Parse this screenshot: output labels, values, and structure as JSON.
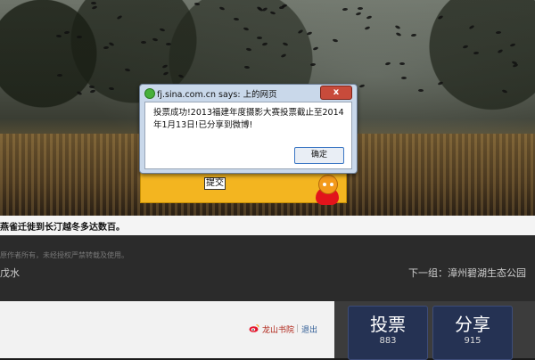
{
  "dialog": {
    "title": "fj.sina.com.cn says: 上的网页",
    "message": "投票成功!2013福建年度摄影大赛投票截止至2014年1月13日!已分享到微博!",
    "close_label": "x",
    "ok_label": "确定"
  },
  "form": {
    "submit_label": "提交"
  },
  "photo": {
    "caption": "燕雀迁徙到长汀越冬多达数百。"
  },
  "info": {
    "copyright": "原作者所有，未经授权严禁转载及使用。",
    "author": "戊水",
    "next_group": "下一组：漳州碧湖生态公园"
  },
  "user": {
    "name": "龙山书院",
    "logout": "退出"
  },
  "actions": {
    "vote_label": "投票",
    "vote_count": "883",
    "share_label": "分享",
    "share_count": "915"
  },
  "colors": {
    "yellow_card": "#f3b520",
    "button_bg": "#253253",
    "close_red": "#c84b3b"
  }
}
